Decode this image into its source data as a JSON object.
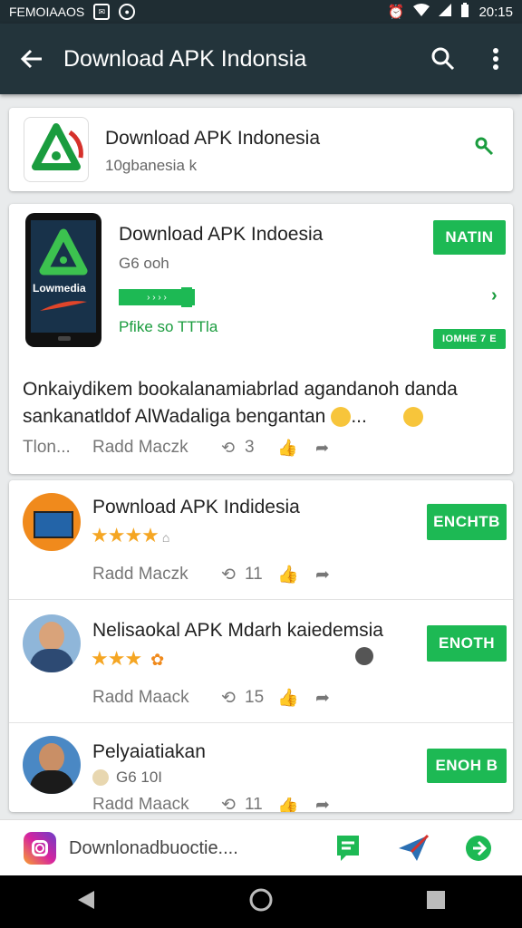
{
  "status": {
    "carrier": "FEMOIAAOS",
    "time": "20:15"
  },
  "appbar": {
    "title": "Download APK Indonsia"
  },
  "search_result": {
    "name": "Download APK Indonesia",
    "subtitle": "10gbanesia k"
  },
  "featured": {
    "name": "Download APK Indoesia",
    "sub1": "G6 ooh",
    "progress_label": "",
    "sub2": "Pfike so TTTla",
    "button": "NATIN",
    "badge": "IOMHE 7 E",
    "phone_brand": "Lowmedia",
    "description_line1": "Onkaiydikem bookalanamiabrlad agandanoh danda",
    "description_line2": "sankanatldof AlWadaliga bengantan",
    "ellipsis": "...",
    "meta_left": "Tlon...",
    "meta_read": "Radd Maczk",
    "meta_count": "3"
  },
  "list": [
    {
      "name": "Pownload APK Indidesia",
      "rating": 3.5,
      "button": "ENCHTB",
      "read": "Radd Maczk",
      "count": "11"
    },
    {
      "name": "Nelisaokal APK Mdarh kaiedemsia",
      "rating": 3,
      "button": "ENOTH",
      "read": "Radd Maack",
      "count": "15"
    },
    {
      "name": "Pelyaiatiakan",
      "sub": "G6 10I",
      "button": "ENOH B",
      "read": "Radd Maack",
      "count": "11"
    }
  ],
  "bottom": {
    "text": "Downlonadbuoctie...."
  }
}
